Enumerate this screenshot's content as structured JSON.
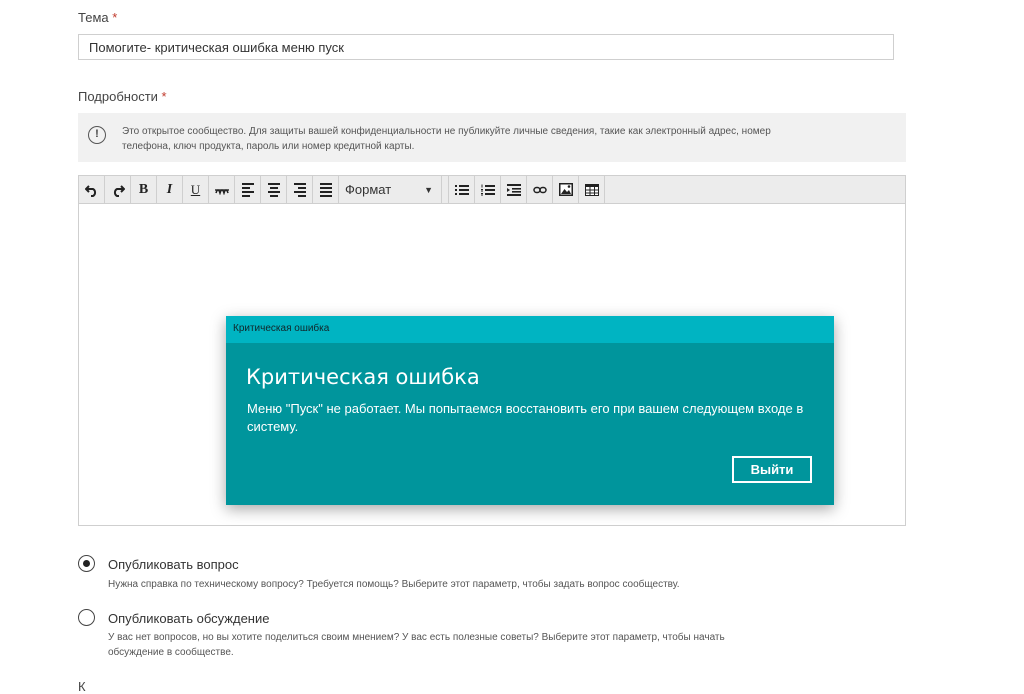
{
  "subject": {
    "label": "Тема",
    "required_mark": "*",
    "value": "Помогите- критическая ошибка меню пуск"
  },
  "details": {
    "label": "Подробности",
    "required_mark": "*"
  },
  "notice": {
    "icon": "info-icon",
    "icon_glyph": "!",
    "text": "Это открытое сообщество. Для защиты вашей конфиденциальности не публикуйте личные сведения, такие как электронный адрес, номер телефона, ключ продукта, пароль или номер кредитной карты."
  },
  "toolbar": {
    "format_label": "Формат",
    "bold_label": "B",
    "italic_label": "I",
    "underline_label": "U"
  },
  "dialog": {
    "title": "Критическая ошибка",
    "heading": "Критическая ошибка",
    "message": "Меню \"Пуск\" не работает. Мы попытаемся восстановить его при вашем следующем входе в систему.",
    "button_label": "Выйти",
    "colors": {
      "titlebar": "#00b4c2",
      "body": "#00959c"
    }
  },
  "options": [
    {
      "title": "Опубликовать вопрос",
      "description": "Нужна справка по техническому вопросу? Требуется помощь? Выберите этот параметр, чтобы задать вопрос сообществу.",
      "selected": true
    },
    {
      "title": "Опубликовать обсуждение",
      "description": "У вас нет вопросов, но вы хотите поделиться своим мнением? У вас есть полезные советы? Выберите этот параметр, чтобы начать обсуждение в сообществе.",
      "selected": false
    }
  ],
  "next_field": {
    "label": "К"
  }
}
